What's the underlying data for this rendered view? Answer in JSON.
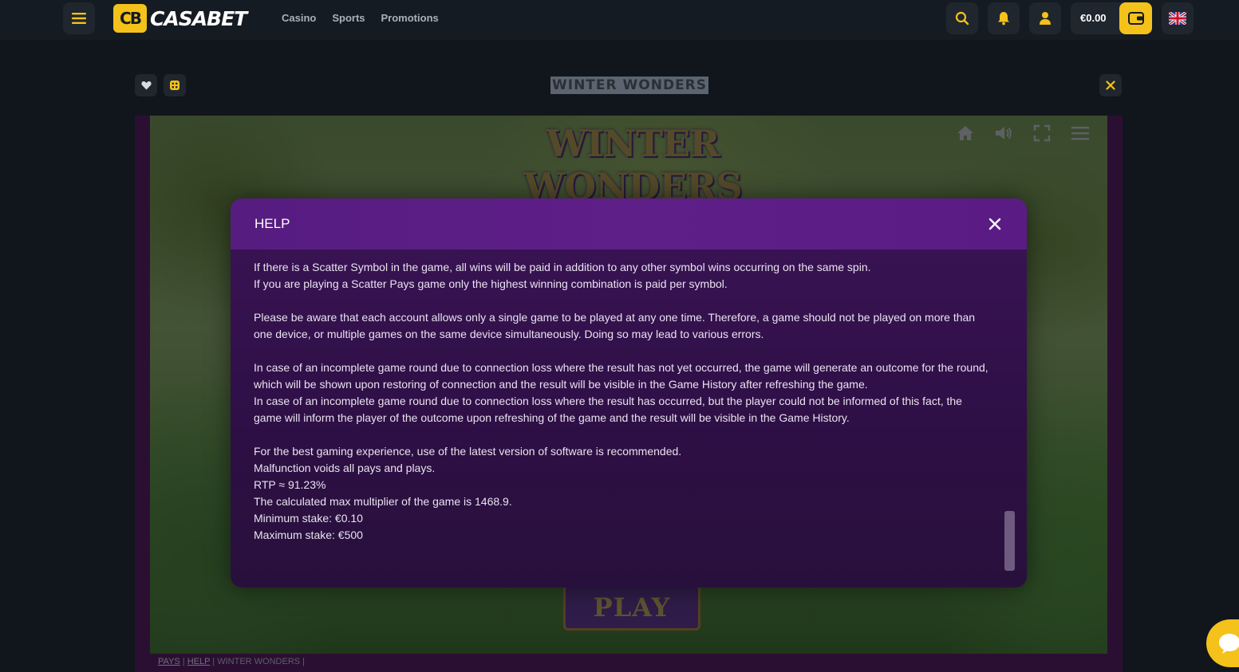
{
  "brand": {
    "badge": "CB",
    "name": "CASABET",
    "accent_color": "#f4c21a"
  },
  "nav": {
    "casino": "Casino",
    "sports": "Sports",
    "promotions": "Promotions"
  },
  "header": {
    "balance": "€0.00",
    "icons": [
      "menu-icon",
      "search-icon",
      "bell-icon",
      "user-icon",
      "wallet-icon",
      "uk-flag-icon"
    ]
  },
  "game": {
    "title": "WINTER WONDERS",
    "scene_logo": "WINTER WONDERS",
    "play_label": "PLAY",
    "scene_icons": [
      "home-icon",
      "sound-icon",
      "fullscreen-icon",
      "hamburger-icon"
    ]
  },
  "help": {
    "title": "HELP",
    "paragraphs": [
      [
        "If there is a Scatter Symbol in the game, all wins will be paid in addition to any other symbol wins occurring on the same spin.",
        "If you are playing a Scatter Pays game only the highest winning combination is paid per symbol."
      ],
      [
        "Please be aware that each account allows only a single game to be played at any one time. Therefore, a game should not be played on more than",
        "one device, or multiple games on the same device simultaneously. Doing so may lead to various errors."
      ],
      [
        "In case of an incomplete game round due to connection loss where the result has not yet occurred, the game will generate an outcome for the round,",
        "which will be shown upon restoring of connection and the result will be visible in the Game History after refreshing the game.",
        "In case of an incomplete game round due to connection loss where the result has occurred, but the player could not be informed of this fact, the",
        "game will inform the player of the outcome upon refreshing of the game and the result will be visible in the Game History."
      ],
      [
        "For the best gaming experience, use of the latest version of software is recommended.",
        "Malfunction voids all pays and plays.",
        "RTP ≈ 91.23%",
        "The calculated max multiplier of the game is 1468.9.",
        "Minimum stake: €0.10",
        "Maximum stake: €500"
      ]
    ]
  },
  "footer_links": {
    "pays": "PAYS",
    "sep1": " | ",
    "help": "HELP",
    "sep2": " | ",
    "game": "WINTER WONDERS",
    "sep3": " |"
  }
}
